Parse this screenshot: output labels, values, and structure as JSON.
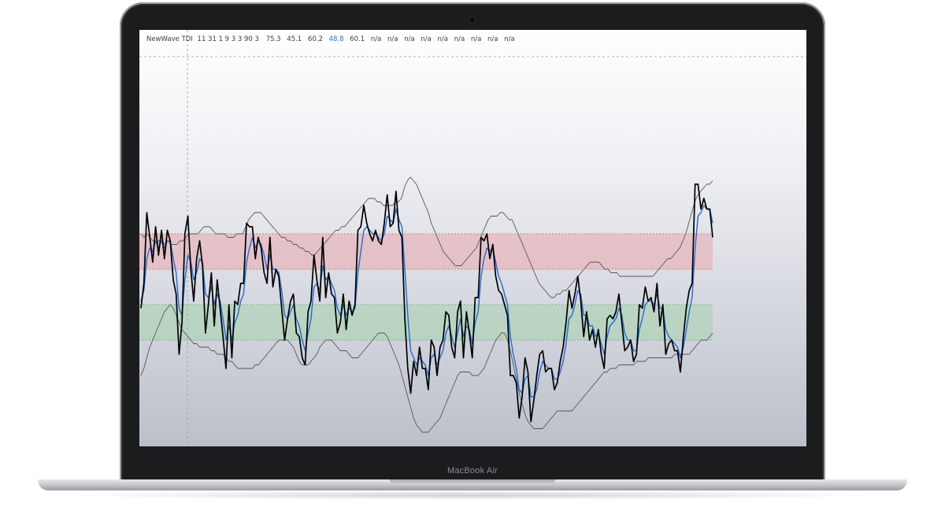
{
  "device": {
    "brand_label": "MacBook Air"
  },
  "legend": {
    "title": "NewWave TDI",
    "params": "11 31 1 9 3 3 90 3",
    "values": [
      "75.3",
      "45.1",
      "60.2",
      "48.8",
      "60.1",
      "n/a",
      "n/a",
      "n/a",
      "n/a",
      "n/a",
      "n/a",
      "n/a",
      "n/a",
      "n/a"
    ],
    "highlight_index": 3
  },
  "colors": {
    "rsi_line": "#000000",
    "signal_line": "#2f6fd6",
    "bands": "#555555",
    "overbought_zone": "#e9a8ad",
    "oversold_zone": "#a6d3ad"
  },
  "chart_data": {
    "type": "line",
    "y_range": [
      10,
      120
    ],
    "zones": [
      {
        "name": "overbought",
        "from": 60,
        "to": 70
      },
      {
        "name": "oversold",
        "from": 40,
        "to": 50
      }
    ],
    "series": [
      {
        "key": "rsi",
        "values": [
          49,
          56,
          76,
          69,
          62,
          72,
          64,
          71,
          63,
          71,
          68,
          57,
          53,
          36,
          45,
          70,
          75,
          60,
          51,
          63,
          68,
          61,
          42,
          50,
          59,
          44,
          57,
          49,
          41,
          32,
          50,
          35,
          51,
          50,
          56,
          56,
          73,
          72,
          72,
          63,
          69,
          66,
          59,
          56,
          69,
          55,
          60,
          58,
          49,
          40,
          46,
          51,
          53,
          42,
          41,
          35,
          33,
          48,
          51,
          64,
          57,
          51,
          69,
          52,
          59,
          53,
          52,
          42,
          45,
          53,
          43,
          51,
          47,
          50,
          71,
          72,
          78,
          73,
          70,
          68,
          71,
          68,
          67,
          73,
          81,
          72,
          73,
          82,
          71,
          69,
          46,
          32,
          25,
          34,
          30,
          38,
          32,
          32,
          26,
          40,
          38,
          30,
          38,
          40,
          48,
          47,
          38,
          35,
          48,
          51,
          35,
          48,
          42,
          35,
          52,
          52,
          69,
          68,
          70,
          63,
          67,
          58,
          54,
          53,
          50,
          47,
          30,
          30,
          28,
          18,
          24,
          35,
          31,
          17,
          23,
          30,
          36,
          37,
          31,
          32,
          32,
          26,
          28,
          34,
          38,
          45,
          54,
          49,
          53,
          58,
          51,
          41,
          48,
          40,
          43,
          38,
          43,
          36,
          32,
          46,
          47,
          46,
          48,
          53,
          45,
          37,
          38,
          40,
          34,
          36,
          50,
          49,
          55,
          51,
          52,
          48,
          56,
          44,
          50,
          36,
          39,
          40,
          37,
          37,
          31,
          41,
          49,
          54,
          56,
          84,
          84,
          77,
          80,
          77,
          77,
          69
        ]
      },
      {
        "key": "signal",
        "values": [
          51,
          54,
          63,
          66,
          65,
          68,
          66,
          68,
          66,
          68,
          68,
          63,
          59,
          49,
          47,
          57,
          64,
          62,
          57,
          59,
          63,
          62,
          53,
          52,
          55,
          50,
          53,
          51,
          46,
          40,
          44,
          40,
          45,
          47,
          51,
          53,
          62,
          66,
          69,
          66,
          68,
          67,
          64,
          60,
          64,
          60,
          60,
          59,
          54,
          47,
          46,
          48,
          50,
          46,
          44,
          40,
          37,
          42,
          46,
          55,
          56,
          54,
          61,
          57,
          58,
          56,
          54,
          49,
          47,
          50,
          47,
          49,
          48,
          49,
          59,
          65,
          71,
          72,
          71,
          70,
          70,
          69,
          68,
          70,
          75,
          74,
          73,
          77,
          74,
          72,
          60,
          47,
          37,
          35,
          33,
          35,
          34,
          33,
          30,
          35,
          36,
          33,
          35,
          37,
          42,
          44,
          41,
          38,
          42,
          46,
          41,
          44,
          43,
          39,
          45,
          48,
          58,
          63,
          66,
          65,
          66,
          62,
          58,
          56,
          53,
          50,
          41,
          36,
          32,
          26,
          25,
          29,
          30,
          24,
          24,
          26,
          31,
          34,
          33,
          32,
          32,
          29,
          29,
          31,
          34,
          39,
          46,
          47,
          50,
          54,
          53,
          47,
          47,
          44,
          44,
          41,
          42,
          39,
          36,
          41,
          44,
          45,
          46,
          49,
          47,
          42,
          40,
          40,
          37,
          37,
          43,
          46,
          50,
          51,
          51,
          50,
          53,
          49,
          49,
          43,
          41,
          40,
          39,
          38,
          35,
          38,
          43,
          48,
          52,
          66,
          75,
          76,
          78,
          77,
          77,
          73
        ]
      },
      {
        "key": "upper_band",
        "values": [
          70,
          69,
          70,
          69,
          68,
          68,
          68,
          68,
          67,
          68,
          67,
          67,
          67,
          68,
          68,
          69,
          70,
          70,
          70,
          70,
          71,
          72,
          72,
          72,
          71,
          70,
          70,
          70,
          70,
          69,
          69,
          69,
          70,
          70,
          70,
          72,
          74,
          75,
          76,
          76,
          76,
          75,
          74,
          73,
          72,
          71,
          70,
          69,
          69,
          68,
          68,
          67,
          67,
          66,
          66,
          65,
          65,
          64,
          64,
          65,
          66,
          67,
          68,
          69,
          70,
          71,
          71,
          72,
          72,
          73,
          74,
          75,
          76,
          77,
          78,
          79,
          80,
          80,
          80,
          79,
          79,
          78,
          78,
          78,
          78,
          79,
          79,
          80,
          83,
          85,
          86,
          85,
          84,
          82,
          80,
          78,
          76,
          73,
          71,
          69,
          67,
          65,
          64,
          63,
          62,
          61,
          61,
          61,
          62,
          63,
          64,
          65,
          66,
          68,
          70,
          72,
          74,
          75,
          75,
          75,
          76,
          76,
          75,
          74,
          74,
          72,
          70,
          68,
          66,
          64,
          62,
          60,
          58,
          56,
          55,
          54,
          53,
          52,
          52,
          53,
          53,
          54,
          54,
          55,
          56,
          57,
          58,
          59,
          60,
          61,
          62,
          62,
          62,
          62,
          61,
          60,
          60,
          59,
          59,
          59,
          58,
          58,
          58,
          58,
          58,
          58,
          58,
          58,
          58,
          58,
          58,
          58,
          59,
          60,
          61,
          62,
          63,
          63,
          64,
          65,
          66,
          68,
          70,
          73,
          76,
          79,
          81,
          82,
          83,
          84,
          84,
          85
        ]
      },
      {
        "key": "lower_band",
        "values": [
          30,
          32,
          35,
          38,
          40,
          42,
          44,
          46,
          48,
          49,
          50,
          49,
          47,
          45,
          43,
          42,
          41,
          40,
          39,
          39,
          38,
          38,
          38,
          38,
          37,
          37,
          36,
          36,
          36,
          35,
          34,
          34,
          33,
          32,
          32,
          32,
          32,
          32,
          32,
          33,
          33,
          34,
          35,
          36,
          37,
          38,
          39,
          40,
          40,
          40,
          40,
          39,
          38,
          36,
          34,
          33,
          33,
          33,
          34,
          35,
          36,
          38,
          39,
          40,
          40,
          40,
          39,
          38,
          37,
          37,
          37,
          36,
          35,
          35,
          35,
          36,
          37,
          38,
          39,
          40,
          41,
          42,
          42,
          42,
          41,
          39,
          37,
          35,
          33,
          30,
          27,
          24,
          21,
          18,
          16,
          15,
          14,
          14,
          14,
          15,
          16,
          17,
          18,
          20,
          22,
          24,
          26,
          28,
          30,
          31,
          31,
          31,
          31,
          30,
          30,
          30,
          31,
          32,
          34,
          36,
          38,
          40,
          41,
          42,
          42,
          40,
          37,
          33,
          29,
          25,
          22,
          19,
          17,
          16,
          15,
          15,
          15,
          15,
          16,
          17,
          18,
          19,
          20,
          20,
          20,
          20,
          20,
          20,
          21,
          22,
          23,
          24,
          25,
          26,
          27,
          28,
          29,
          30,
          31,
          31,
          32,
          32,
          32,
          33,
          33,
          33,
          33,
          33,
          33,
          34,
          34,
          34,
          34,
          35,
          35,
          35,
          35,
          35,
          35,
          35,
          35,
          35,
          36,
          36,
          36,
          36,
          36,
          36,
          37,
          38,
          39,
          40,
          40,
          40,
          41,
          42
        ]
      }
    ]
  }
}
